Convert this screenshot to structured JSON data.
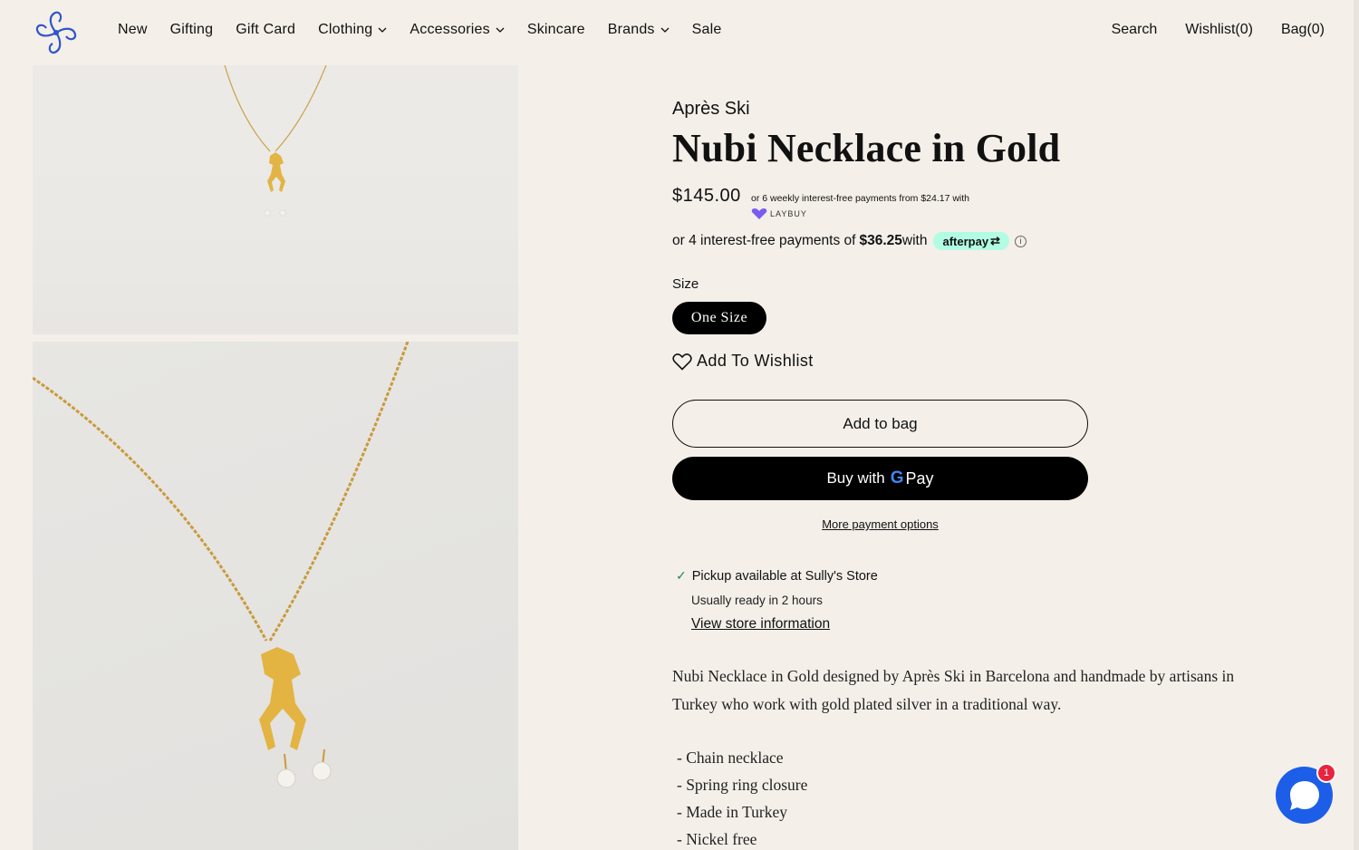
{
  "nav": {
    "items": [
      {
        "label": "New",
        "has_dropdown": false
      },
      {
        "label": "Gifting",
        "has_dropdown": false
      },
      {
        "label": "Gift Card",
        "has_dropdown": false
      },
      {
        "label": "Clothing",
        "has_dropdown": true
      },
      {
        "label": "Accessories",
        "has_dropdown": true
      },
      {
        "label": "Skincare",
        "has_dropdown": false
      },
      {
        "label": "Brands",
        "has_dropdown": true
      },
      {
        "label": "Sale",
        "has_dropdown": false
      }
    ],
    "search": "Search",
    "wishlist": "Wishlist(0)",
    "bag": "Bag(0)"
  },
  "product": {
    "brand": "Après Ski",
    "title": "Nubi Necklace in Gold",
    "price": "$145.00",
    "laybuy_text": "or 6 weekly interest-free payments from  $24.17  with",
    "laybuy_logo": "LAYBUY",
    "afterpay_text": "or 4 interest-free payments of ",
    "afterpay_amount": "$36.25",
    "afterpay_with": " with",
    "afterpay_logo": "afterpay",
    "size_label": "Size",
    "size_option": "One Size",
    "wishlist_label": "Add To Wishlist",
    "add_to_bag": "Add to bag",
    "buy_with": "Buy with",
    "gpay_g": "G",
    "gpay_pay": "Pay",
    "more_payment": "More payment options",
    "pickup": "Pickup available at Sully's Store",
    "ready": "Usually ready in 2 hours",
    "store_link": "View store information",
    "description": "Nubi Necklace in Gold designed by Après Ski in Barcelona and handmade by artisans in Turkey who work with gold plated silver in a traditional way.",
    "features": [
      "- Chain necklace",
      "- Spring ring closure",
      "- Made in Turkey",
      "- Nickel free"
    ]
  },
  "chat": {
    "badge": "1"
  },
  "colors": {
    "background": "#f4efe9",
    "accent": "#1c5ee7",
    "afterpay": "#b2fce4",
    "badge": "#e8243f"
  }
}
